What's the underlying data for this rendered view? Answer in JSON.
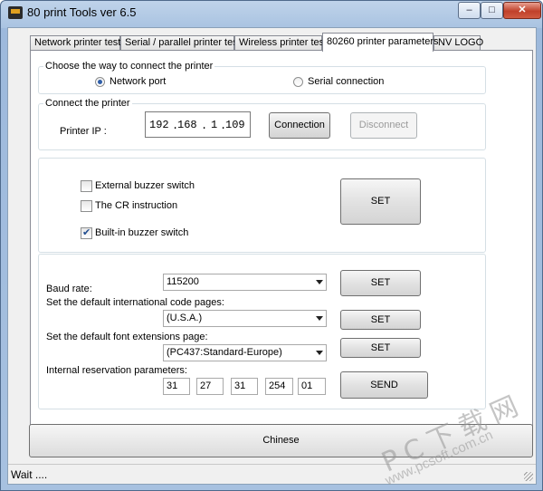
{
  "window": {
    "title": "80 print Tools ver 6.5",
    "minimize_label": "–",
    "maximize_label": "□",
    "close_label": "✕"
  },
  "tabs": [
    {
      "label": "Network printer test"
    },
    {
      "label": "Serial / parallel printer test"
    },
    {
      "label": "Wireless printer test"
    },
    {
      "label": "80260 printer parameters"
    },
    {
      "label": "NV LOGO"
    }
  ],
  "connection_way": {
    "title": "Choose the way to connect the printer",
    "network_label": "Network port",
    "serial_label": "Serial connection",
    "selected": "Network port"
  },
  "connect": {
    "title": "Connect the printer",
    "ip_label": "Printer IP :",
    "ip": [
      "192",
      "168",
      "1",
      "109"
    ],
    "connect_label": "Connection",
    "disconnect_label": "Disconnect"
  },
  "buzzer": {
    "external_label": "External buzzer switch",
    "external_checked": false,
    "cr_label": "The CR instruction",
    "cr_checked": false,
    "builtin_label": "Built-in buzzer switch",
    "builtin_checked": true,
    "set_label": "SET"
  },
  "settings": {
    "baud_label": "Baud rate:",
    "baud_value": "115200",
    "baud_set": "SET",
    "codepage_label": "Set the default international code pages:",
    "codepage_value": "(U.S.A.)",
    "codepage_set": "SET",
    "font_label": "Set the default font extensions page:",
    "font_value": "(PC437:Standard-Europe)",
    "font_set": "SET",
    "reserve_label": "Internal reservation parameters:",
    "reserve_values": [
      "31",
      "27",
      "31",
      "254",
      "01"
    ],
    "send_label": "SEND"
  },
  "language_button": "Chinese",
  "status": "Wait ....",
  "watermark": {
    "line1": "PC下载网",
    "line2": "www.pcsoft.com.cn"
  }
}
